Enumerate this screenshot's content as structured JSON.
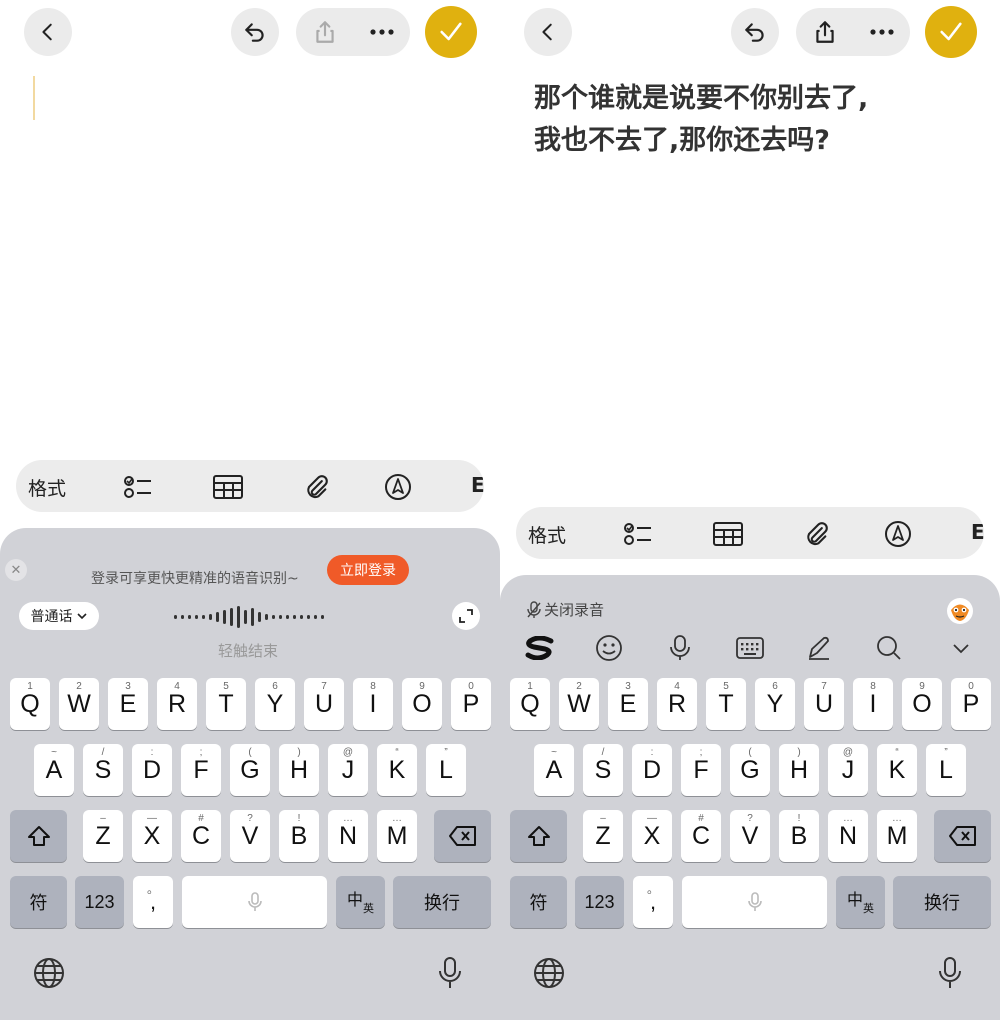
{
  "colors": {
    "accent": "#e0b10f",
    "login": "#f05a28",
    "keyboard_bg": "#d1d2d7"
  },
  "icons": [
    "back-icon",
    "undo-icon",
    "share-icon",
    "more-icon",
    "check-icon",
    "checklist-icon",
    "table-icon",
    "paperclip-icon",
    "pen-icon",
    "close-icon",
    "expand-icon",
    "mic-icon",
    "globe-icon",
    "delete-icon",
    "shift-icon",
    "sogou-logo-icon",
    "emoji-icon",
    "keyboard-grid-icon",
    "handwriting-icon",
    "search-icon",
    "chevron-down-icon",
    "mascot-icon"
  ],
  "left": {
    "toolbar": {
      "format": "格式",
      "more_letter": "E"
    },
    "voice": {
      "login_tip": "登录可享更快更精准的语音识别~",
      "login_button": "立即登录",
      "language": "普通话",
      "tap_to_end": "轻触结束"
    }
  },
  "right": {
    "note": {
      "line1": "那个谁就是说要不你别去了,",
      "line2": "我也不去了,那你还去吗?"
    },
    "toolbar": {
      "format": "格式",
      "more_letter": "E"
    },
    "kb_toolbar": {
      "mic_off": "关闭录音"
    }
  },
  "keys": {
    "row1": [
      {
        "k": "Q",
        "h": "1"
      },
      {
        "k": "W",
        "h": "2"
      },
      {
        "k": "E",
        "h": "3"
      },
      {
        "k": "R",
        "h": "4"
      },
      {
        "k": "T",
        "h": "5"
      },
      {
        "k": "Y",
        "h": "6"
      },
      {
        "k": "U",
        "h": "7"
      },
      {
        "k": "I",
        "h": "8"
      },
      {
        "k": "O",
        "h": "9"
      },
      {
        "k": "P",
        "h": "0"
      }
    ],
    "row2": [
      {
        "k": "A",
        "h": "~"
      },
      {
        "k": "S",
        "h": "/"
      },
      {
        "k": "D",
        "h": ":"
      },
      {
        "k": "F",
        "h": ";"
      },
      {
        "k": "G",
        "h": "("
      },
      {
        "k": "H",
        "h": ")"
      },
      {
        "k": "J",
        "h": "@"
      },
      {
        "k": "K",
        "h": "“"
      },
      {
        "k": "L",
        "h": "”"
      }
    ],
    "row3": [
      {
        "k": "Z",
        "h": "–"
      },
      {
        "k": "X",
        "h": "—"
      },
      {
        "k": "C",
        "h": "#"
      },
      {
        "k": "V",
        "h": "?"
      },
      {
        "k": "B",
        "h": "!"
      },
      {
        "k": "N",
        "h": "…"
      },
      {
        "k": "M",
        "h": "…"
      }
    ],
    "symbols": "符",
    "numbers": "123",
    "punct": ",",
    "punct_hint": "。",
    "lang_main": "中",
    "lang_sub": "英",
    "enter": "换行"
  }
}
